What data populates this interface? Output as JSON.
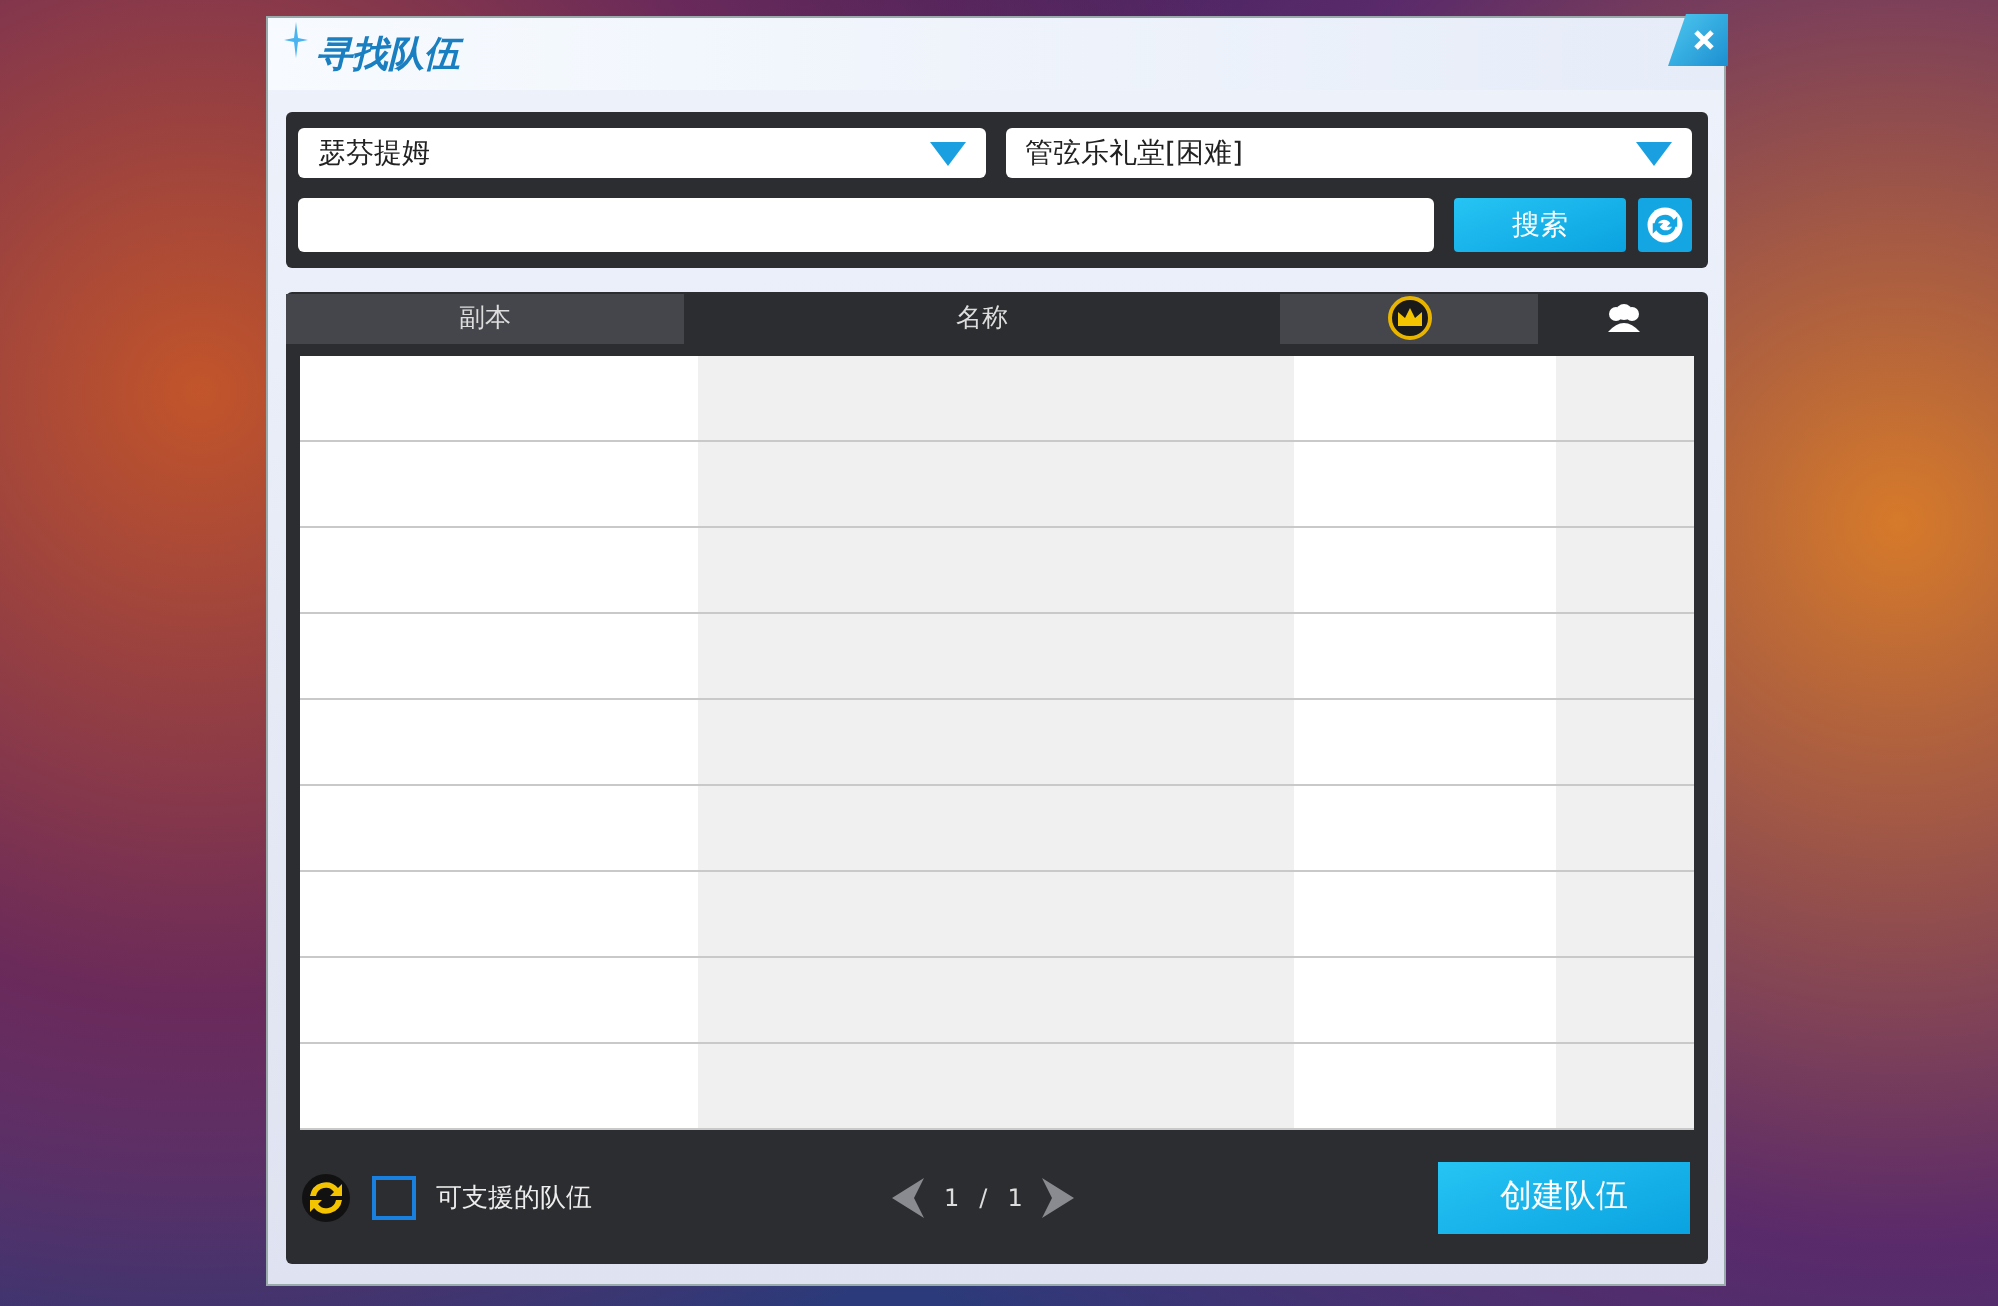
{
  "window": {
    "title": "寻找队伍"
  },
  "filters": {
    "region": {
      "value": "瑟芬提姆"
    },
    "dungeon": {
      "value": "管弦乐礼堂[困难]"
    },
    "search": {
      "button": "搜索"
    }
  },
  "table": {
    "columns": [
      {
        "kind": "text",
        "label": "副本"
      },
      {
        "kind": "text",
        "label": "名称"
      },
      {
        "kind": "crown"
      },
      {
        "kind": "people"
      }
    ]
  },
  "footer": {
    "support_filter": {
      "label": "可支援的队伍",
      "checked": false
    },
    "pager": {
      "current": "1",
      "separator": "/",
      "total": "1"
    },
    "create_button": "创建队伍"
  }
}
